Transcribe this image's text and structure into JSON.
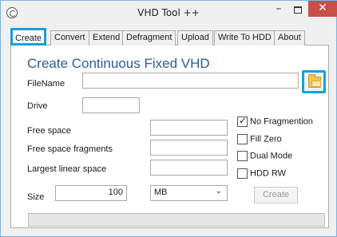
{
  "window": {
    "title": "VHD Tool ++"
  },
  "tabs": [
    "Create",
    "Convert",
    "Extend",
    "Defragment",
    "Upload",
    "Write To HDD",
    "About"
  ],
  "active_tab": "Create",
  "form": {
    "heading": "Create Continuous Fixed VHD",
    "filename_label": "FileName",
    "filename_value": "",
    "drive_label": "Drive",
    "drive_value": "",
    "free_space_label": "Free space",
    "free_space_value": "",
    "free_fragments_label": "Free space fragments",
    "free_fragments_value": "",
    "largest_linear_label": "Largest linear space",
    "largest_linear_value": "",
    "size_label": "Size",
    "size_value": "100",
    "unit_selected": "MB",
    "create_button": "Create",
    "progress_percent": 0
  },
  "options": [
    {
      "label": "No Fragmention",
      "checked": true
    },
    {
      "label": "Fill Zero",
      "checked": false
    },
    {
      "label": "Dual Mode",
      "checked": false
    },
    {
      "label": "HDD RW",
      "checked": false
    }
  ],
  "colors": {
    "accent_highlight": "#18a0d8",
    "heading": "#2c5c9a",
    "close_button": "#c7504a"
  }
}
